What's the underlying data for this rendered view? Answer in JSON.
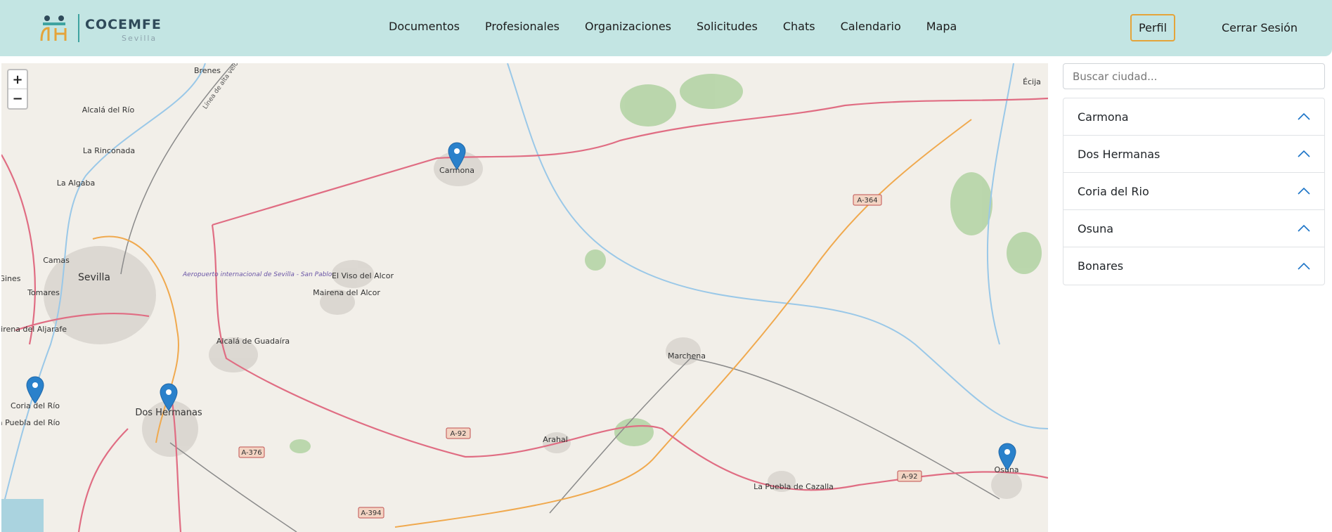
{
  "brand": {
    "name": "COCEMFE",
    "sub": "Sevilla"
  },
  "nav": {
    "items": [
      "Documentos",
      "Profesionales",
      "Organizaciones",
      "Solicitudes",
      "Chats",
      "Calendario",
      "Mapa"
    ],
    "perfil": "Perfil",
    "logout": "Cerrar Sesión"
  },
  "map": {
    "zoom_in": "+",
    "zoom_out": "−",
    "places": [
      "Brenes",
      "Alcalá del Río",
      "La Rinconada",
      "La Algaba",
      "Camas",
      "Gines",
      "Sevilla",
      "Tomares",
      "Mairena del Aljarafe",
      "Coria del Río",
      "La Puebla del Río",
      "Dos Hermanas",
      "Alcalá de Guadaíra",
      "Carmona",
      "El Viso del Alcor",
      "Mairena del Alcor",
      "Marchena",
      "Arahal",
      "La Puebla de Cazalla",
      "Osuna",
      "Écija",
      "Aeropuerto internacional de Sevilla - San Pablo",
      "Línea de alta velocidad"
    ],
    "roads": [
      "A-364",
      "A-92",
      "A-376",
      "A-394"
    ],
    "markers": [
      "Carmona",
      "Dos Hermanas",
      "Coria del Río",
      "Osuna"
    ]
  },
  "sidebar": {
    "search_placeholder": "Buscar ciudad...",
    "cities": [
      "Carmona",
      "Dos Hermanas",
      "Coria del Rio",
      "Osuna",
      "Bonares"
    ]
  },
  "colors": {
    "header_bg": "#c3e5e3",
    "perfil_border": "#e4a43a",
    "marker": "#2a81cb",
    "chevron": "#1a73c7",
    "road_major": "#e06d83",
    "road_motorway": "#f0a94e",
    "map_bg": "#f2efe9"
  }
}
